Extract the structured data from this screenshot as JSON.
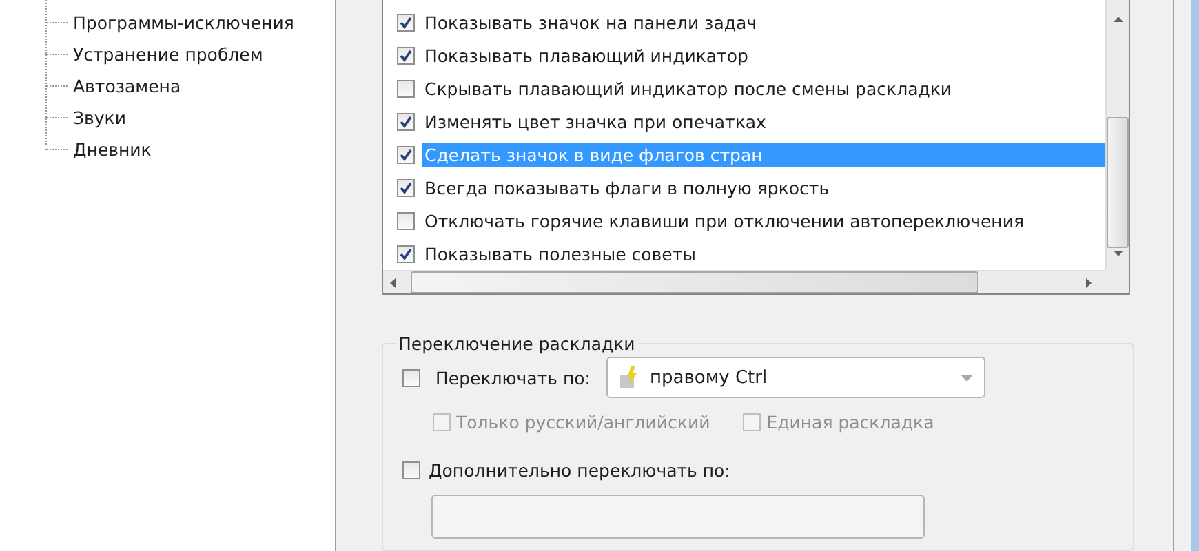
{
  "sidebar": {
    "items": [
      {
        "label": "Программы-исключения",
        "selected": false
      },
      {
        "label": "Устранение проблем",
        "selected": false
      },
      {
        "label": "Автозамена",
        "selected": false
      },
      {
        "label": "Звуки",
        "selected": false
      },
      {
        "label": "Дневник",
        "selected": false
      }
    ]
  },
  "options": [
    {
      "label": "Показывать значок на панели задач",
      "checked": true,
      "selected": false
    },
    {
      "label": "Показывать плавающий индикатор",
      "checked": true,
      "selected": false
    },
    {
      "label": "Скрывать плавающий индикатор после смены раскладки",
      "checked": false,
      "selected": false
    },
    {
      "label": "Изменять цвет значка при опечатках",
      "checked": true,
      "selected": false
    },
    {
      "label": "Сделать значок в виде флагов стран",
      "checked": true,
      "selected": true
    },
    {
      "label": "Всегда показывать флаги в полную яркость",
      "checked": true,
      "selected": false
    },
    {
      "label": "Отключать горячие клавиши при отключении автопереключения",
      "checked": false,
      "selected": false
    },
    {
      "label": "Показывать полезные советы",
      "checked": true,
      "selected": false
    }
  ],
  "layout_switch": {
    "title": "Переключение раскладки",
    "switch_by": {
      "label": "Переключать по:",
      "checked": false,
      "value": "правому Ctrl"
    },
    "sub_options": [
      {
        "label": "Только русский/английский",
        "checked": false,
        "disabled": true
      },
      {
        "label": "Единая раскладка",
        "checked": false,
        "disabled": true
      }
    ],
    "extra": {
      "label": "Дополнительно переключать по:",
      "checked": false
    }
  }
}
